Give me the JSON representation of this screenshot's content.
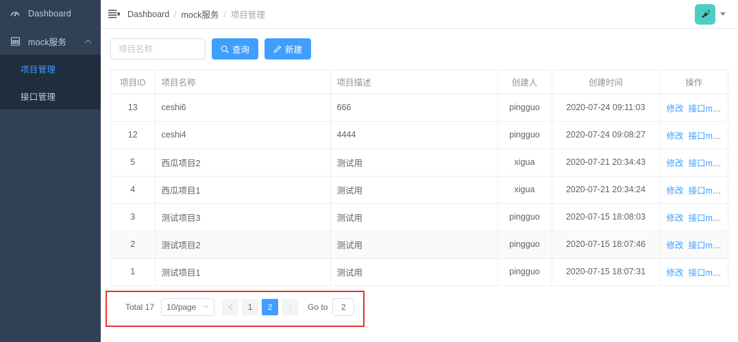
{
  "sidebar": {
    "items": [
      {
        "label": "Dashboard",
        "icon": "dashboard-gauge-icon",
        "has_children": false
      },
      {
        "label": "mock服务",
        "icon": "grid-table-icon",
        "has_children": true,
        "expanded": true,
        "children": [
          {
            "label": "项目管理",
            "active": true
          },
          {
            "label": "接口管理",
            "active": false
          }
        ]
      }
    ],
    "bg_color": "#304156",
    "submenu_bg_color": "#1f2d3d",
    "active_color": "#409EFF"
  },
  "navbar": {
    "hamburger_icon": "hamburger-fold-icon",
    "breadcrumb": [
      "Dashboard",
      "mock服务",
      "项目管理"
    ],
    "breadcrumb_separator": "/",
    "avatar_icon": "user-avatar-icon",
    "avatar_color": "#4ecdc4",
    "dropdown_icon": "caret-down-icon"
  },
  "toolbar": {
    "search_placeholder": "项目名称",
    "search_value": "",
    "query_label": "查询",
    "query_icon": "search-icon",
    "create_label": "新建",
    "create_icon": "edit-pencil-icon",
    "button_color": "#409EFF"
  },
  "table": {
    "columns": [
      "项目ID",
      "项目名称",
      "项目描述",
      "创建人",
      "创建时间",
      "操作"
    ],
    "actions": {
      "edit_label": "修改",
      "mock_label": "接口mock"
    },
    "hovered_row_index": 5,
    "rows": [
      {
        "id": "13",
        "name": "ceshi6",
        "desc": "666",
        "creator": "pingguo",
        "created": "2020-07-24 09:11:03"
      },
      {
        "id": "12",
        "name": "ceshi4",
        "desc": "4444",
        "creator": "pingguo",
        "created": "2020-07-24 09:08:27"
      },
      {
        "id": "5",
        "name": "西瓜项目2",
        "desc": "测试用",
        "creator": "xigua",
        "created": "2020-07-21 20:34:43"
      },
      {
        "id": "4",
        "name": "西瓜项目1",
        "desc": "测试用",
        "creator": "xigua",
        "created": "2020-07-21 20:34:24"
      },
      {
        "id": "3",
        "name": "测试项目3",
        "desc": "测试用",
        "creator": "pingguo",
        "created": "2020-07-15 18:08:03"
      },
      {
        "id": "2",
        "name": "测试项目2",
        "desc": "测试用",
        "creator": "pingguo",
        "created": "2020-07-15 18:07:46"
      },
      {
        "id": "1",
        "name": "测试项目1",
        "desc": "测试用",
        "creator": "pingguo",
        "created": "2020-07-15 18:07:31"
      }
    ]
  },
  "pagination": {
    "total_label": "Total 17",
    "page_size_label": "10/page",
    "prev_icon": "chevron-left-icon",
    "next_icon": "chevron-right-icon",
    "pages": [
      "1",
      "2"
    ],
    "active_page": "2",
    "goto_label": "Go to",
    "goto_value": "2",
    "active_color": "#409EFF",
    "highlight_color": "#e8312f"
  }
}
